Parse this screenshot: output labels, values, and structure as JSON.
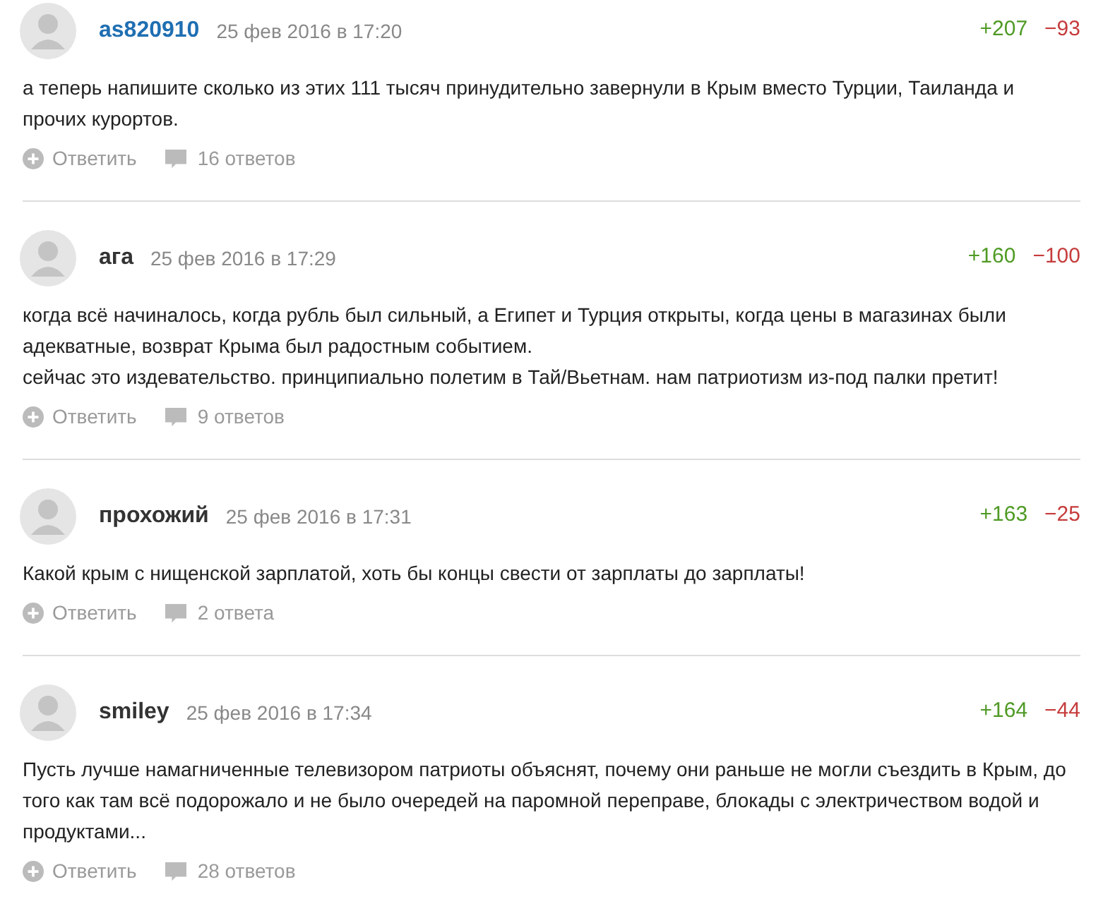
{
  "comments": [
    {
      "author": "as820910",
      "highlighted": true,
      "date": "25 фев 2016 в 17:20",
      "plus": "+207",
      "minus": "−93",
      "text": "а теперь напишите сколько из этих 111 тысяч принудительно завернули в Крым вместо Турции, Таиланда и прочих курортов.",
      "reply": "Ответить",
      "replies": "16 ответов"
    },
    {
      "author": "ага",
      "highlighted": false,
      "date": "25 фев 2016 в 17:29",
      "plus": "+160",
      "minus": "−100",
      "text": "когда всё начиналось, когда рубль был сильный, а Египет и Турция открыты, когда цены в магазинах были адекватные, возврат Крыма был радостным событием.\nсейчас это издевательство. принципиально полетим в Тай/Вьетнам. нам патриотизм из-под палки претит!",
      "reply": "Ответить",
      "replies": "9 ответов"
    },
    {
      "author": "прохожий",
      "highlighted": false,
      "date": "25 фев 2016 в 17:31",
      "plus": "+163",
      "minus": "−25",
      "text": "Какой крым с нищенской зарплатой, хоть бы концы свести от зарплаты до зарплаты!",
      "reply": "Ответить",
      "replies": "2 ответа"
    },
    {
      "author": "smiley",
      "highlighted": false,
      "date": "25 фев 2016 в 17:34",
      "plus": "+164",
      "minus": "−44",
      "text": "Пусть лучше намагниченные телевизором патриоты объяснят, почему они раньше не могли съездить в Крым, до того как там всё подорожало и не было очередей на паромной переправе, блокады с электричеством водой и продуктами...",
      "reply": "Ответить",
      "replies": "28 ответов"
    }
  ]
}
